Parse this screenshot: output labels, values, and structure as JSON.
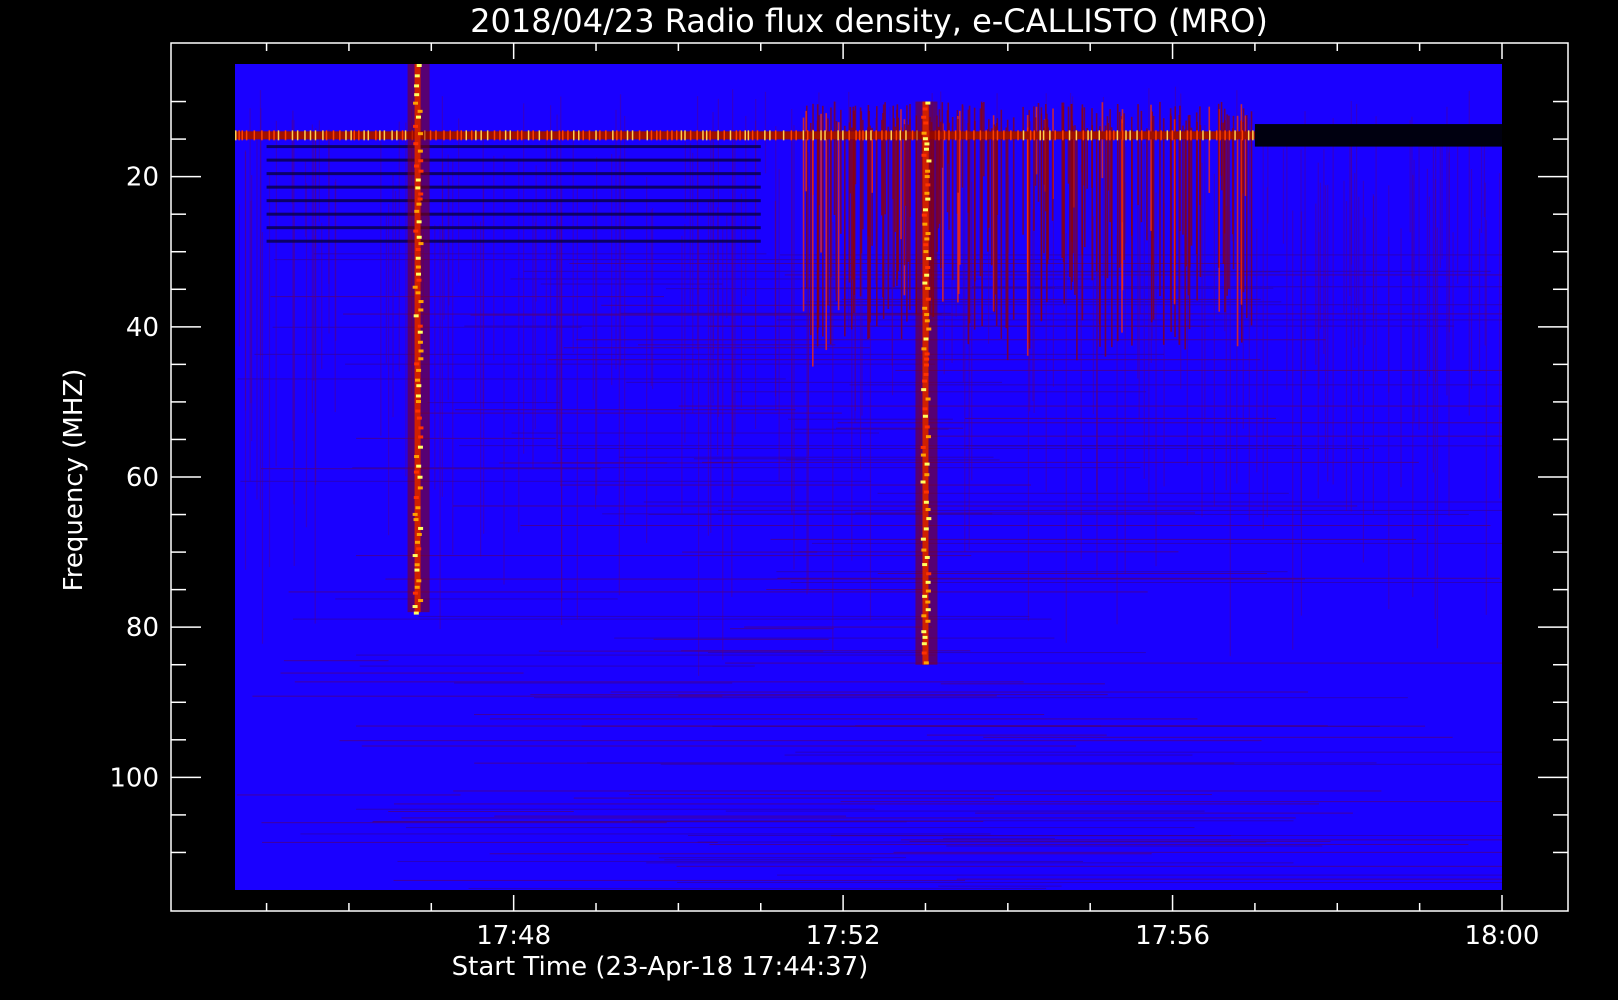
{
  "chart_data": {
    "type": "heatmap",
    "title": "2018/04/23  Radio flux density, e-CALLISTO (MRO)",
    "xlabel": "Start Time (23-Apr-18 17:44:37)",
    "ylabel": "Frequency (MHZ)",
    "x_ticks": [
      "17:48",
      "17:52",
      "17:56",
      "18:00"
    ],
    "x_tick_values": [
      48,
      52,
      56,
      60
    ],
    "y_ticks": [
      "20",
      "40",
      "60",
      "80",
      "100"
    ],
    "y_tick_values": [
      20,
      40,
      60,
      80,
      100
    ],
    "xlim": [
      "17:44:37",
      "18:00"
    ],
    "ylim": [
      115,
      5
    ],
    "y_axis_inverted": true,
    "colormap": [
      "#000000",
      "#2a00a0",
      "#1a00ff",
      "#9a0000",
      "#ff2000",
      "#ffb000",
      "#ffff80"
    ],
    "background_color": "#1a00ff",
    "features": [
      {
        "type": "interference_band",
        "freq_mhz": 14.5,
        "time_range": [
          "17:44:37",
          "17:57:00"
        ]
      },
      {
        "type": "dark_band",
        "freq_range_mhz": [
          13,
          16
        ],
        "time_range": [
          "17:57:00",
          "18:00"
        ]
      },
      {
        "type": "radio_burst",
        "time": "17:46:50",
        "freq_range_mhz": [
          5,
          78
        ]
      },
      {
        "type": "radio_burst",
        "time": "17:53:00",
        "freq_range_mhz": [
          10,
          85
        ]
      },
      {
        "type": "burst_cluster",
        "time_range": [
          "17:51:30",
          "17:57:00"
        ],
        "freq_range_mhz": [
          10,
          40
        ]
      },
      {
        "type": "dark_rfi_bands",
        "freq_range_mhz": [
          14,
          30
        ],
        "time_range": [
          "17:45:00",
          "17:51:00"
        ]
      }
    ]
  }
}
